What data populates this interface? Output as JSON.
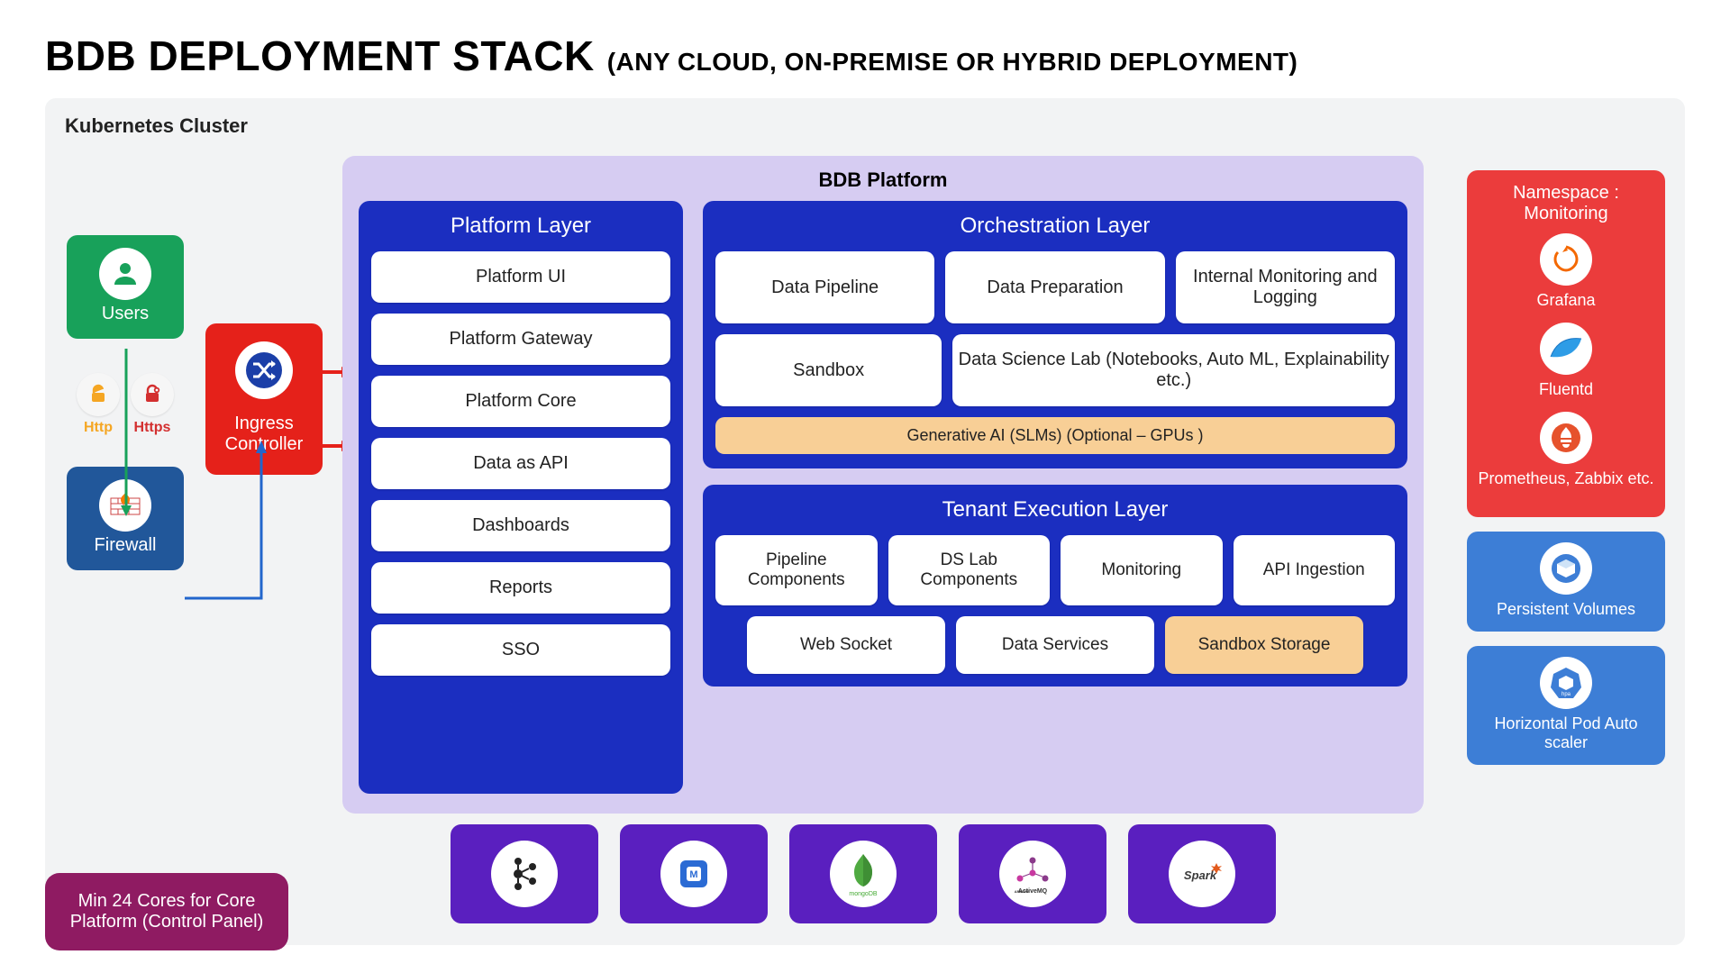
{
  "title": {
    "main": "BDB DEPLOYMENT STACK",
    "sub": "(ANY CLOUD, ON-PREMISE OR HYBRID DEPLOYMENT)"
  },
  "cluster": {
    "title": "Kubernetes Cluster"
  },
  "users": {
    "label": "Users"
  },
  "protocols": {
    "http": "Http",
    "https": "Https"
  },
  "firewall": {
    "label": "Firewall"
  },
  "ingress": {
    "label": "Ingress Controller"
  },
  "platform": {
    "title": "BDB Platform",
    "platform_layer": {
      "title": "Platform Layer",
      "items": [
        "Platform UI",
        "Platform Gateway",
        "Platform Core",
        "Data as API",
        "Dashboards",
        "Reports",
        "SSO"
      ]
    },
    "orchestration_layer": {
      "title": "Orchestration  Layer",
      "row1": [
        "Data Pipeline",
        "Data Preparation",
        "Internal Monitoring and Logging"
      ],
      "row2": [
        "Sandbox",
        "Data Science Lab (Notebooks, Auto ML, Explainability etc.)"
      ],
      "genai": "Generative AI (SLMs)  (Optional – GPUs )"
    },
    "tenant_layer": {
      "title": "Tenant Execution Layer",
      "row1": [
        "Pipeline Components",
        "DS Lab Components",
        "Monitoring",
        "API Ingestion"
      ],
      "row2": [
        "Web Socket",
        "Data Services",
        "Sandbox Storage"
      ]
    }
  },
  "infra": {
    "items": [
      "Kafka",
      "Micro-svc",
      "mongoDB",
      "ActiveMQ",
      "Spark"
    ]
  },
  "monitoring": {
    "title": "Namespace : Monitoring",
    "items": [
      "Grafana",
      "Fluentd",
      "Prometheus, Zabbix etc."
    ]
  },
  "persistent_volumes": {
    "label": "Persistent Volumes"
  },
  "hpa": {
    "label": "Horizontal Pod Auto scaler"
  },
  "min_cores": {
    "label": "Min 24 Cores for Core Platform (Control Panel)"
  }
}
